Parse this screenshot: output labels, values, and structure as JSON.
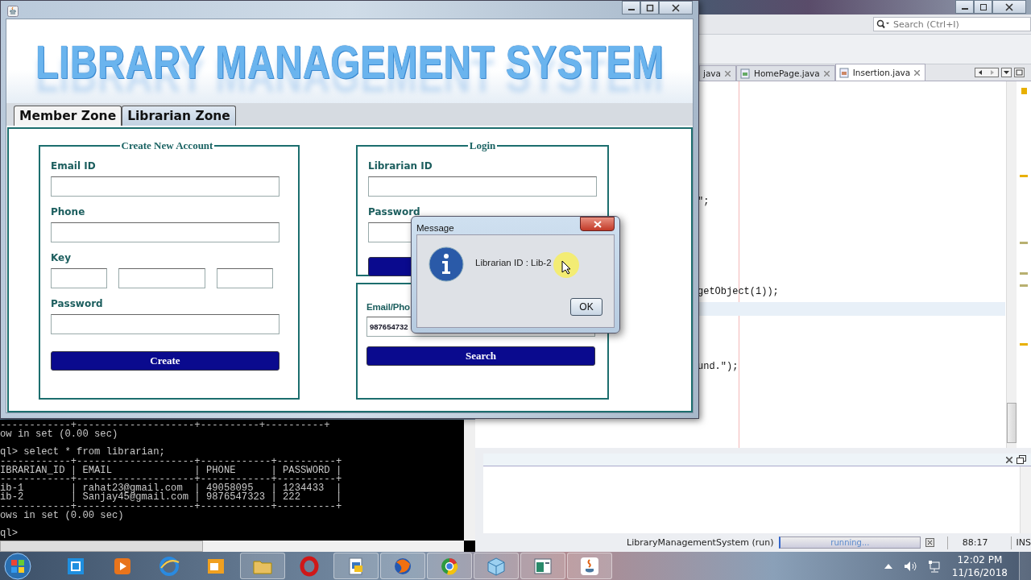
{
  "app_window": {
    "banner_title": "LIBRARY MANAGEMENT SYSTEM",
    "tabs": [
      {
        "label": "Member Zone",
        "selected": false
      },
      {
        "label": "Librarian Zone",
        "selected": true
      }
    ],
    "create_panel": {
      "title": "Create New Account",
      "fields": [
        {
          "kind": "text",
          "label": "Email ID"
        },
        {
          "kind": "text",
          "label": "Phone"
        },
        {
          "kind": "key",
          "label": "Key"
        },
        {
          "kind": "text",
          "label": "Password"
        }
      ],
      "button": "Create"
    },
    "login_panel": {
      "title": "Login",
      "fields": [
        {
          "label": "Librarian ID"
        },
        {
          "label": "Password"
        }
      ]
    },
    "search_panel": {
      "label": "Email/Pho",
      "value": "987654732",
      "button": "Search"
    }
  },
  "dialog": {
    "title": "Message",
    "message": "Librarian ID : Lib-2",
    "button": "OK"
  },
  "console": {
    "blocks": [
      [
        "------------+--------------------+----------+----------+",
        "ow in set (0.00 sec)"
      ],
      [
        "ql> select * from librarian;",
        "------------+--------------------+------------+----------+",
        "IBRARIAN_ID | EMAIL              | PHONE      | PASSWORD |",
        "------------+--------------------+------------+----------+",
        "ib-1        | rahat23@gmail.com  | 49058095   | 1234433  |",
        "ib-2        | Sanjay45@gmail.com | 9876547323 | 222      |",
        "------------+--------------------+------------+----------+",
        "ows in set (0.00 sec)"
      ],
      [
        "ql>"
      ]
    ]
  },
  "ide": {
    "search": {
      "placeholder": "Search (Ctrl+I)"
    },
    "tabs": [
      {
        "label": "java",
        "selected": false
      },
      {
        "label": "HomePage.java",
        "selected": false
      },
      {
        "label": "Insertion.java",
        "selected": true
      }
    ],
    "code_lines": [
      {
        "text": "\";"
      },
      {
        "text": "getObject(1));"
      },
      {
        "text": "und.\");"
      }
    ],
    "status": {
      "task": "LibraryManagementSystem (run)",
      "progress": "running...",
      "level": 1,
      "position": "88:17",
      "mode": "INS"
    }
  },
  "taskbar": {
    "time": "12:02 PM",
    "date": "11/16/2018"
  }
}
